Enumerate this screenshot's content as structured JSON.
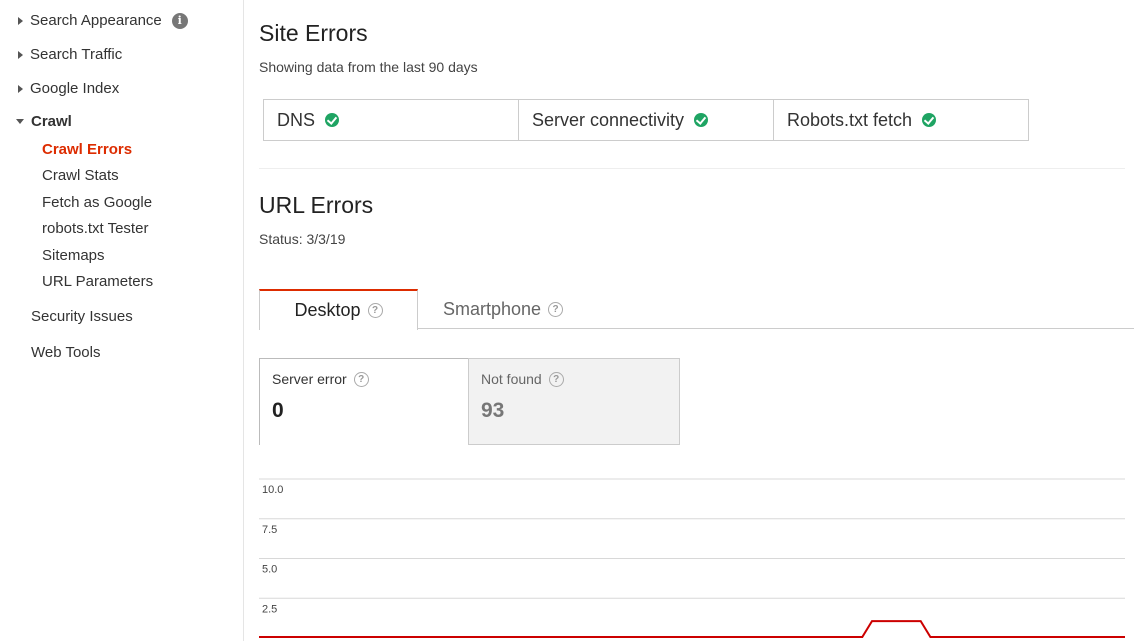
{
  "sidebar": {
    "search_appearance": "Search Appearance",
    "search_traffic": "Search Traffic",
    "google_index": "Google Index",
    "crawl": "Crawl",
    "crawl_items": [
      "Crawl Errors",
      "Crawl Stats",
      "Fetch as Google",
      "robots.txt Tester",
      "Sitemaps",
      "URL Parameters"
    ],
    "security_issues": "Security Issues",
    "web_tools": "Web Tools",
    "active_item": "Crawl Errors"
  },
  "site_errors": {
    "title": "Site Errors",
    "subtitle": "Showing data from the last 90 days",
    "checks": [
      {
        "label": "DNS",
        "status": "ok"
      },
      {
        "label": "Server connectivity",
        "status": "ok"
      },
      {
        "label": "Robots.txt fetch",
        "status": "ok"
      }
    ]
  },
  "url_errors": {
    "title": "URL Errors",
    "status": "Status: 3/3/19",
    "tabs": [
      {
        "label": "Desktop",
        "active": true
      },
      {
        "label": "Smartphone",
        "active": false
      }
    ],
    "metrics": [
      {
        "label": "Server error",
        "value": "0",
        "active": true
      },
      {
        "label": "Not found",
        "value": "93",
        "active": false
      }
    ]
  },
  "colors": {
    "accent": "#dd2c00",
    "ok": "#1fa463",
    "series": "#cc0000"
  },
  "chart_data": {
    "type": "line",
    "yticks": [
      "10.0",
      "7.5",
      "5.0",
      "2.5"
    ],
    "ylim": [
      0,
      10
    ],
    "series": [
      {
        "values": [
          0,
          0,
          0,
          0,
          0,
          0,
          0,
          0,
          0,
          0,
          0,
          0,
          0,
          0,
          0,
          0,
          0,
          0,
          0,
          0,
          0,
          0,
          0,
          0,
          0,
          0,
          0,
          0,
          0,
          0,
          0,
          0,
          0,
          0,
          0,
          0,
          0,
          0,
          0,
          0,
          0,
          0,
          0,
          0,
          0,
          0,
          0,
          0,
          0,
          0,
          0,
          0,
          0,
          0,
          0,
          0,
          0,
          0,
          0,
          0,
          0,
          0,
          0,
          1,
          1,
          1,
          1,
          1,
          1,
          0,
          0,
          0,
          0,
          0,
          0,
          0,
          0,
          0,
          0,
          0,
          0,
          0,
          0,
          0,
          0,
          0,
          0,
          0,
          0,
          0
        ]
      }
    ]
  }
}
